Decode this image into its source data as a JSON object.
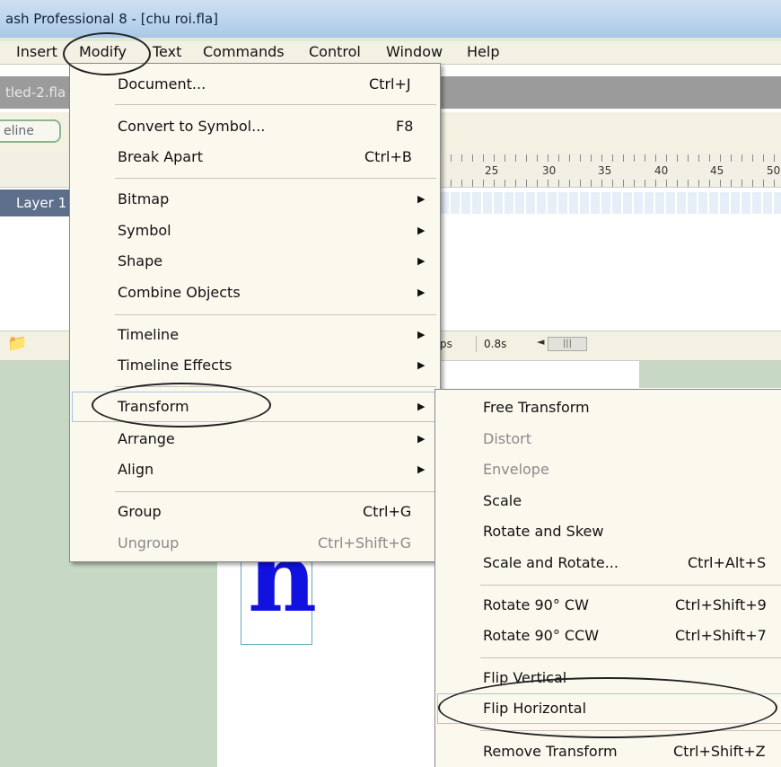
{
  "window": {
    "title": "ash Professional 8 - [chu roi.fla]"
  },
  "menubar": [
    "Insert",
    "Modify",
    "Text",
    "Commands",
    "Control",
    "Window",
    "Help"
  ],
  "background": {
    "doc_tab": "tled-2.fla",
    "timeline_tab": "eline",
    "ruler_numbers": [
      "25",
      "30",
      "35",
      "40",
      "45",
      "50"
    ],
    "layer_label": "Layer 1",
    "fps": "ps",
    "time": "0.8s",
    "stage_letter": "h"
  },
  "modify_menu": {
    "items": [
      {
        "label": "Document...",
        "shortcut": "Ctrl+J"
      },
      {
        "label": "Convert to Symbol...",
        "shortcut": "F8"
      },
      {
        "label": "Break Apart",
        "shortcut": "Ctrl+B"
      },
      {
        "label": "Bitmap",
        "submenu": true
      },
      {
        "label": "Symbol",
        "submenu": true
      },
      {
        "label": "Shape",
        "submenu": true
      },
      {
        "label": "Combine Objects",
        "submenu": true
      },
      {
        "label": "Timeline",
        "submenu": true
      },
      {
        "label": "Timeline Effects",
        "submenu": true
      },
      {
        "label": "Transform",
        "submenu": true
      },
      {
        "label": "Arrange",
        "submenu": true
      },
      {
        "label": "Align",
        "submenu": true
      },
      {
        "label": "Group",
        "shortcut": "Ctrl+G"
      },
      {
        "label": "Ungroup",
        "shortcut": "Ctrl+Shift+G",
        "disabled": true
      }
    ]
  },
  "transform_menu": {
    "items": [
      {
        "label": "Free Transform"
      },
      {
        "label": "Distort",
        "disabled": true
      },
      {
        "label": "Envelope",
        "disabled": true
      },
      {
        "label": "Scale"
      },
      {
        "label": "Rotate and Skew"
      },
      {
        "label": "Scale and Rotate...",
        "shortcut": "Ctrl+Alt+S"
      },
      {
        "label": "Rotate 90° CW",
        "shortcut": "Ctrl+Shift+9"
      },
      {
        "label": "Rotate 90° CCW",
        "shortcut": "Ctrl+Shift+7"
      },
      {
        "label": "Flip Vertical"
      },
      {
        "label": "Flip Horizontal"
      },
      {
        "label": "Remove Transform",
        "shortcut": "Ctrl+Shift+Z"
      }
    ]
  },
  "icons": {
    "submenu_arrow": "▶",
    "scroll_left": "◄",
    "footer": "📁"
  },
  "colors": {
    "title_bar": "#b9d3ec",
    "menu_bg": "#fbf8ee",
    "stage_letter": "#1111e0",
    "stage_bg": "#c7d9c5"
  }
}
